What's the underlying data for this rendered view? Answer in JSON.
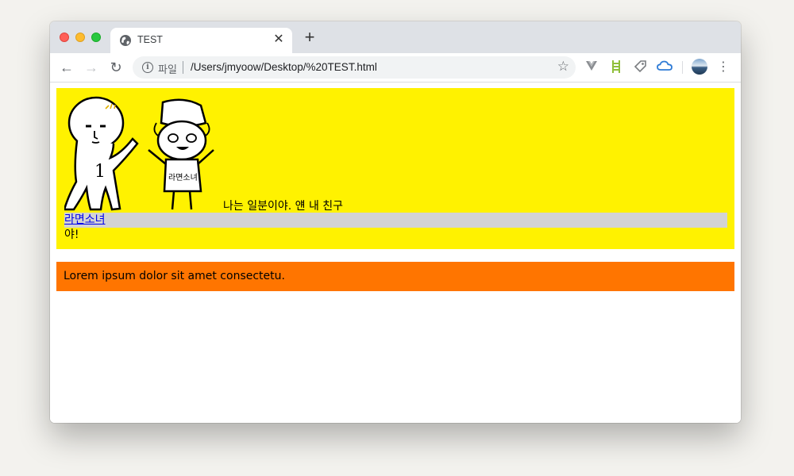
{
  "tab": {
    "title": "TEST",
    "close": "✕",
    "new_tab": "+"
  },
  "toolbar": {
    "back": "←",
    "forward": "→",
    "reload": "↻",
    "scheme_label": "파일",
    "url": "/Users/jmyoow/Desktop/%20TEST.html",
    "star": "☆",
    "menu": "⋮",
    "extensions": [
      "vue-devtools-icon",
      "ladder-icon",
      "tag-icon",
      "cloud-icon"
    ]
  },
  "page": {
    "caption": "나는 일분이야. 얜 내 친구",
    "link_text": "라면소녀",
    "suffix": "야!",
    "orange_text": "Lorem ipsum dolor sit amet consectetu.",
    "image_text": {
      "left_number": "1",
      "right_shirt": "라면소녀"
    }
  },
  "colors": {
    "yellow": "#fff200",
    "orange": "#ff7500",
    "gray_bar": "#d3d3d3",
    "link": "#0000ee"
  }
}
